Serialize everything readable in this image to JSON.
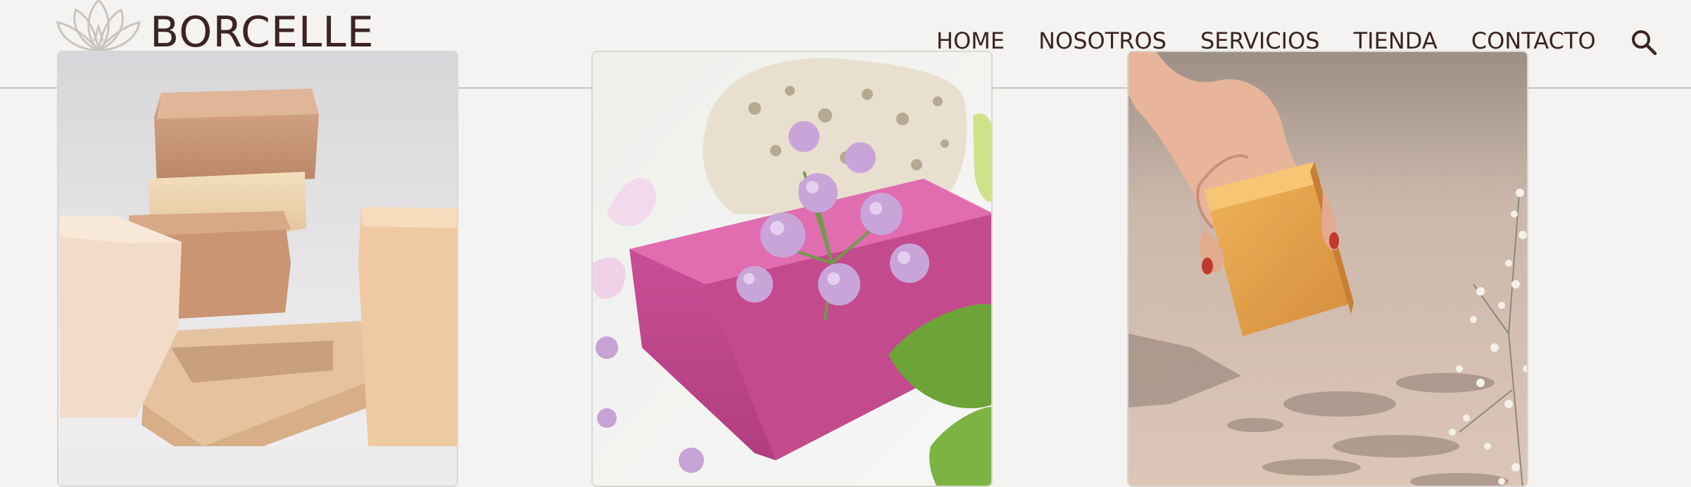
{
  "brand": {
    "name": "BORCELLE",
    "icon": "lotus-icon"
  },
  "nav": {
    "items": [
      {
        "label": "HOME"
      },
      {
        "label": "NOSOTROS"
      },
      {
        "label": "SERVICIOS"
      },
      {
        "label": "TIENDA"
      },
      {
        "label": "CONTACTO"
      }
    ],
    "search_icon": "search-icon"
  },
  "products": [
    {
      "image": "stacked-natural-soap-bars"
    },
    {
      "image": "pink-soap-with-flowers"
    },
    {
      "image": "hand-holding-amber-soap"
    }
  ],
  "colors": {
    "background": "#f4f3f1",
    "text": "#3b2423",
    "divider": "#c4c0bc"
  }
}
